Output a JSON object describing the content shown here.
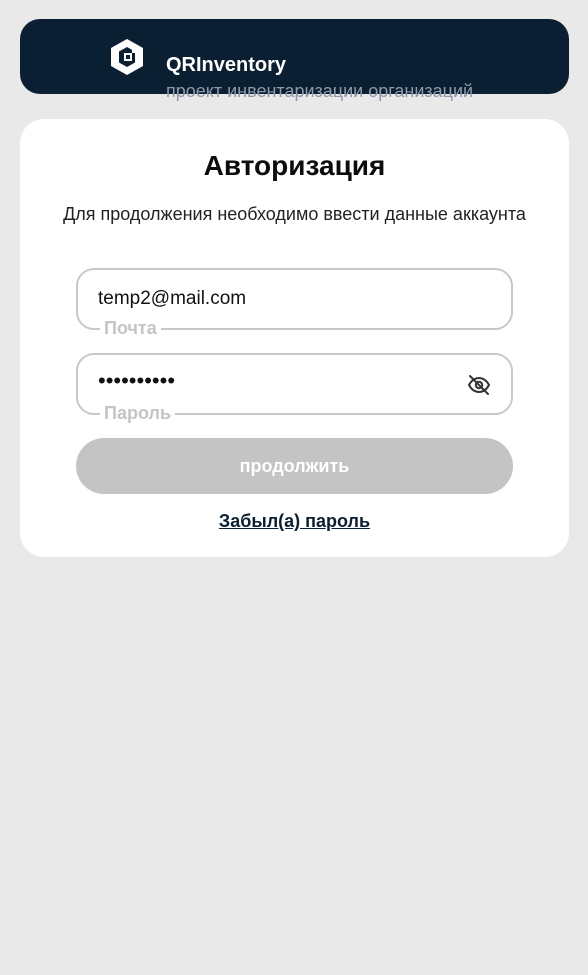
{
  "header": {
    "title": "QRInventory",
    "subtitle": "проект инвентаризации организаций",
    "logo_icon": "qr-hexagon-logo-icon"
  },
  "login": {
    "title": "Авторизация",
    "description": "Для продолжения необходимо ввести данные аккаунта",
    "email": {
      "value": "temp2@mail.com",
      "label": "Почта"
    },
    "password": {
      "value": "••••••••••",
      "label": "Пароль",
      "toggle_icon": "eye-off-icon"
    },
    "submit_label": "продолжить",
    "forgot_label": "Забыл(а) пароль"
  },
  "colors": {
    "header_bg": "#0b1f33",
    "page_bg": "#e9e9e9",
    "button_disabled": "#c4c4c4",
    "border": "#c8c8c8"
  }
}
